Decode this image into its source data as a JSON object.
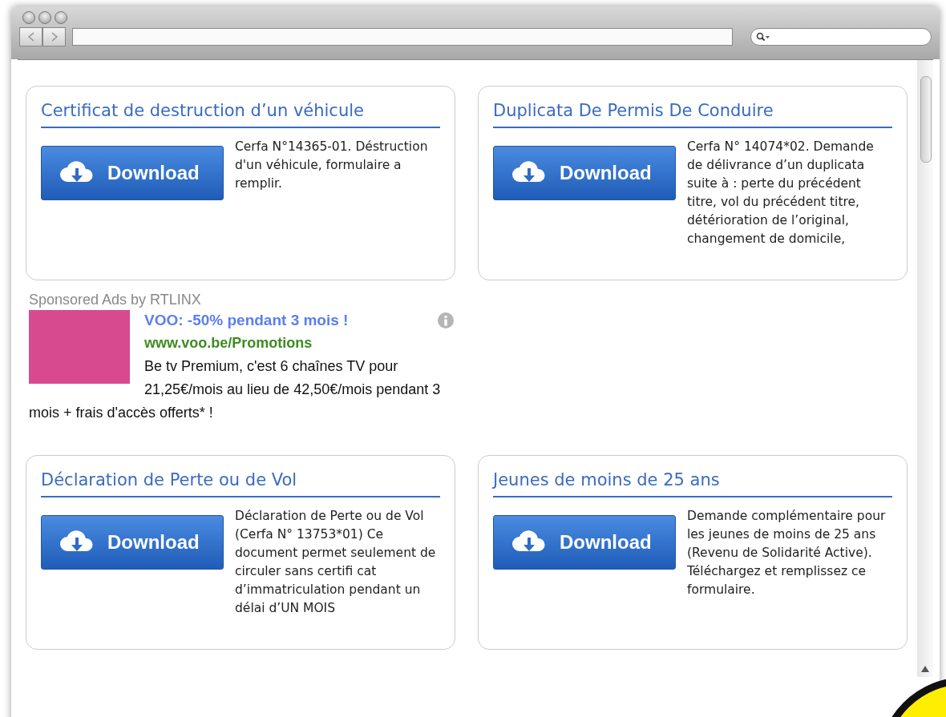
{
  "cards_top": [
    {
      "title": "Certificat de destruction d’un véhicule",
      "button": "Download",
      "description": "Cerfa N°14365-01. Déstruction d'un véhicule, formulaire a remplir."
    },
    {
      "title": "Duplicata De Permis De Conduire",
      "button": "Download",
      "description": "Cerfa N° 14074*02. Demande de délivrance d’un duplicata suite à : perte du précédent titre, vol du précédent titre, détérioration de l’original, changement de domicile,"
    }
  ],
  "ad": {
    "sponsor": "Sponsored Ads by RTLINX",
    "headline": "VOO: -50% pendant 3 mois !",
    "url": "www.voo.be/Promotions",
    "description": "Be tv Premium, c'est 6 chaînes TV pour 21,25€/mois au lieu de 42,50€/mois pendant 3 mois + frais d'accès offerts* !"
  },
  "cards_bottom": [
    {
      "title": "Déclaration de Perte ou de Vol",
      "button": "Download",
      "description": "Déclaration de Perte ou de Vol (Cerfa N° 13753*01) Ce document permet seulement de circuler sans certifi cat d’immatriculation pendant un délai d’UN MOIS"
    },
    {
      "title": "Jeunes de moins de 25 ans",
      "button": "Download",
      "description": "Demande complémentaire pour les jeunes de moins de 25 ans (Revenu de Solidarité Active). Téléchargez et remplissez ce formulaire."
    }
  ]
}
